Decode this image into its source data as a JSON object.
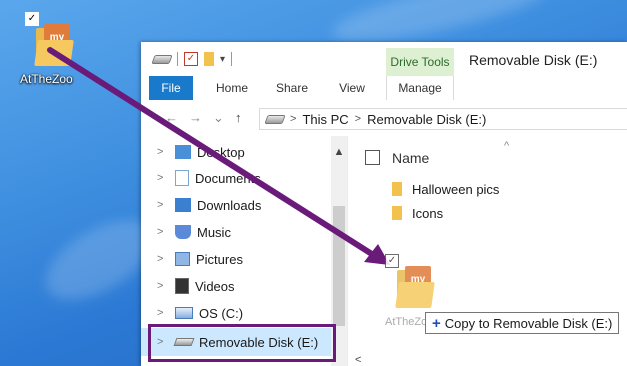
{
  "desktop": {
    "icon": {
      "label": "AtTheZoo",
      "badge_text": "my"
    }
  },
  "window": {
    "quick_access_arrow": "▾",
    "context_tab": "Drive Tools",
    "title": "Removable Disk (E:)",
    "ribbon_tabs": [
      "File",
      "Home",
      "Share",
      "View",
      "Manage"
    ],
    "address": {
      "segments": [
        "This PC",
        "Removable Disk (E:)"
      ],
      "separator": ">"
    },
    "nav_buttons": {
      "back": "←",
      "forward": "→",
      "recent": "⌄",
      "up": "↑"
    }
  },
  "navpane": {
    "expander": ">",
    "items": [
      {
        "label": "Desktop",
        "icon": "desktop-folder-icon"
      },
      {
        "label": "Documents",
        "icon": "documents-folder-icon"
      },
      {
        "label": "Downloads",
        "icon": "downloads-folder-icon"
      },
      {
        "label": "Music",
        "icon": "music-folder-icon"
      },
      {
        "label": "Pictures",
        "icon": "pictures-folder-icon"
      },
      {
        "label": "Videos",
        "icon": "videos-folder-icon"
      },
      {
        "label": "OS (C:)",
        "icon": "os-drive-icon"
      },
      {
        "label": "Removable Disk (E:)",
        "icon": "usb-drive-icon"
      }
    ]
  },
  "content": {
    "column_header": "Name",
    "sort_indicator": "^",
    "files": [
      {
        "name": "Halloween pics"
      },
      {
        "name": "Icons"
      }
    ]
  },
  "drag": {
    "ghost_label": "AtTheZoo",
    "ghost_check": "✓",
    "tooltip_plus": "+",
    "tooltip_text": "Copy to Removable Disk (E:)"
  },
  "colors": {
    "annotation": "#6a1b7a",
    "file_tab": "#1979ca",
    "drive_tools": "#ddf0d2",
    "selection": "#cce8ff"
  }
}
